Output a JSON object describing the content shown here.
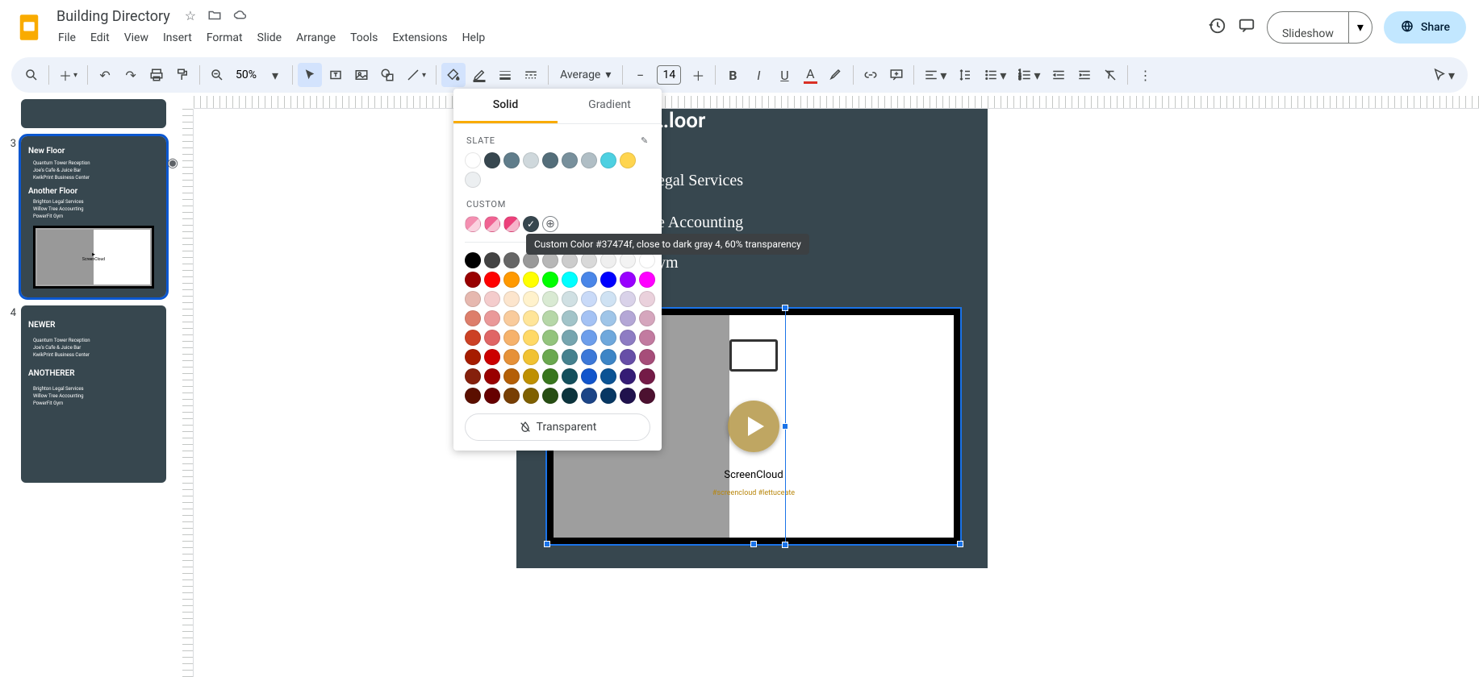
{
  "doc": {
    "title": "Building Directory"
  },
  "menus": [
    "File",
    "Edit",
    "View",
    "Insert",
    "Format",
    "Slide",
    "Arrange",
    "Tools",
    "Extensions",
    "Help"
  ],
  "header": {
    "slideshow": "Slideshow",
    "share": "Share"
  },
  "toolbar": {
    "zoom": "50%",
    "font": "Average",
    "fontsize": "14"
  },
  "colorpicker": {
    "tab_solid": "Solid",
    "tab_gradient": "Gradient",
    "section_slate": "SLATE",
    "section_custom": "CUSTOM",
    "transparent": "Transparent",
    "tooltip": "Custom Color #37474f, close to dark gray 4, 60% transparency",
    "slate": [
      "#ffffff",
      "#37474f",
      "#607d8b",
      "#cfd8dc",
      "#546e7a",
      "#78909c",
      "#b0bec5",
      "#4dd0e1",
      "#ffd54f",
      "#eceff1"
    ],
    "custom": [
      "#f48fb1",
      "#f06292",
      "#ec407a",
      "#37474f"
    ],
    "grid_row1": [
      "#000000",
      "#434343",
      "#666666",
      "#999999",
      "#b7b7b7",
      "#cccccc",
      "#d9d9d9",
      "#efefef",
      "#f3f3f3",
      "#ffffff"
    ],
    "grid_row2": [
      "#980000",
      "#ff0000",
      "#ff9900",
      "#ffff00",
      "#00ff00",
      "#00ffff",
      "#4a86e8",
      "#0000ff",
      "#9900ff",
      "#ff00ff"
    ],
    "grid_row3": [
      "#e6b8af",
      "#f4cccc",
      "#fce5cd",
      "#fff2cc",
      "#d9ead3",
      "#d0e0e3",
      "#c9daf8",
      "#cfe2f3",
      "#d9d2e9",
      "#ead1dc"
    ],
    "grid_row4": [
      "#dd7e6b",
      "#ea9999",
      "#f9cb9c",
      "#ffe599",
      "#b6d7a8",
      "#a2c4c9",
      "#a4c2f4",
      "#9fc5e8",
      "#b4a7d6",
      "#d5a6bd"
    ],
    "grid_row5": [
      "#cc4125",
      "#e06666",
      "#f6b26b",
      "#ffd966",
      "#93c47d",
      "#76a5af",
      "#6d9eeb",
      "#6fa8dc",
      "#8e7cc3",
      "#c27ba0"
    ],
    "grid_row6": [
      "#a61c00",
      "#cc0000",
      "#e69138",
      "#f1c232",
      "#6aa84f",
      "#45818e",
      "#3c78d8",
      "#3d85c6",
      "#674ea7",
      "#a64d79"
    ],
    "grid_row7": [
      "#85200c",
      "#990000",
      "#b45f06",
      "#bf9000",
      "#38761d",
      "#134f5c",
      "#1155cc",
      "#0b5394",
      "#351c75",
      "#741b47"
    ],
    "grid_row8": [
      "#5b0f00",
      "#660000",
      "#783f04",
      "#7f6000",
      "#274e13",
      "#0c343d",
      "#1c4587",
      "#073763",
      "#20124d",
      "#4c1130"
    ]
  },
  "thumbs": {
    "num3": "3",
    "num4": "4",
    "slide3": {
      "h1": "New Floor",
      "items1": [
        "Quantum Tower Reception",
        "Joe's Cafe & Juice Bar",
        "KwikPrint Business Center"
      ],
      "h2": "Another Floor",
      "items2": [
        "Brighton Legal Services",
        "Willow Tree Accounting",
        "PowerFit Gym"
      ]
    },
    "slide4": {
      "h1": "NEWER",
      "items1": [
        "Quantum Tower Reception",
        "Joe's Cafe & Juice Bar",
        "KwikPrint Business Center"
      ],
      "h2": "ANOTHERER",
      "items2": [
        "Brighton Legal Services",
        "Willow Tree Accounting",
        "PowerFit Gym"
      ]
    }
  },
  "slide": {
    "title_partial": "…loor",
    "line1": "…egal Services",
    "line2": "…e Accounting",
    "line3": "…ym",
    "sc_label": "ScreenCloud",
    "sc_sub": "#screencloud #lettuceate"
  }
}
